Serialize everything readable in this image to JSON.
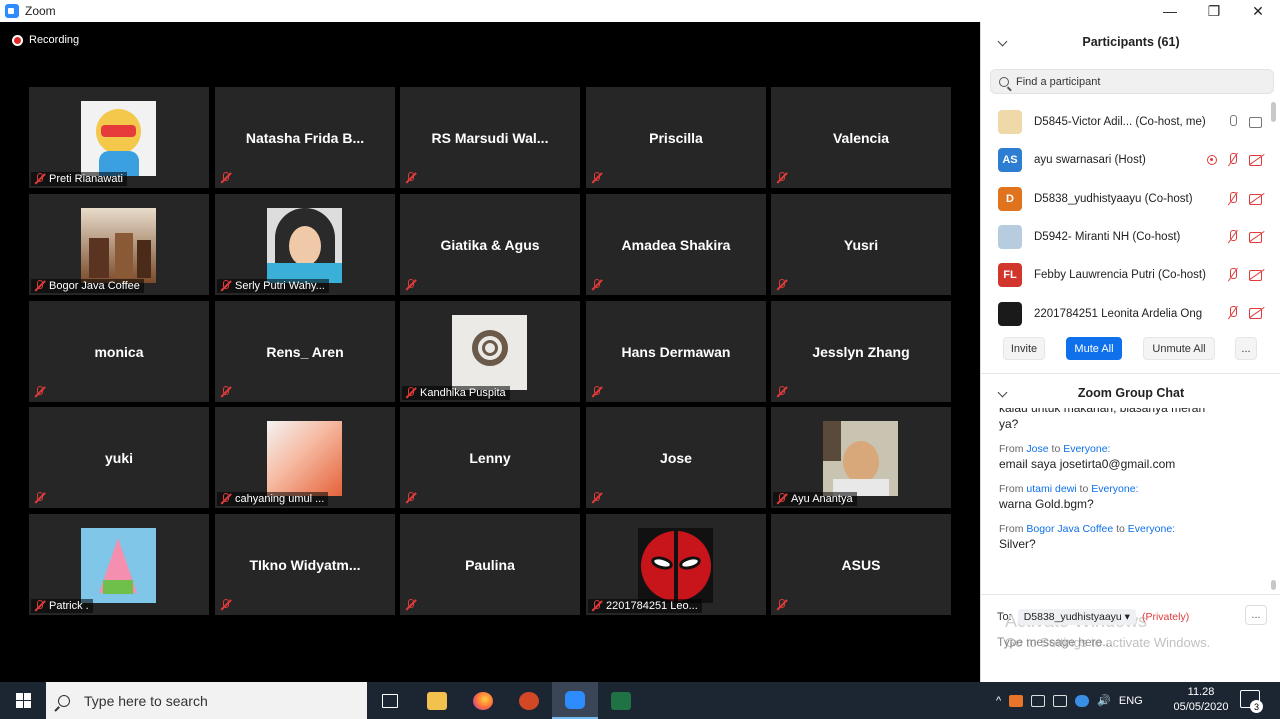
{
  "window": {
    "title": "Zoom"
  },
  "video": {
    "recording_label": "Recording",
    "tiles": [
      {
        "name": "Preti Rianawati",
        "avatar": "cartoon"
      },
      {
        "name": "Natasha Frida B..."
      },
      {
        "name": "RS  Marsudi  Wal..."
      },
      {
        "name": "Priscilla"
      },
      {
        "name": "Valencia"
      },
      {
        "name": "Bogor Java Coffee",
        "avatar": "coffee"
      },
      {
        "name": "Serly Putri Wahy...",
        "avatar": "hijab"
      },
      {
        "name": "Giatika & Agus"
      },
      {
        "name": "Amadea Shakira"
      },
      {
        "name": "Yusri"
      },
      {
        "name": "monica"
      },
      {
        "name": "Rens_ Aren"
      },
      {
        "name": "Kandhika Puspita",
        "avatar": "logo"
      },
      {
        "name": "Hans Dermawan"
      },
      {
        "name": "Jesslyn Zhang"
      },
      {
        "name": "yuki"
      },
      {
        "name": "cahyaning umul ...",
        "avatar": "orange"
      },
      {
        "name": "Lenny"
      },
      {
        "name": "Jose"
      },
      {
        "name": "Ayu Anantya",
        "avatar": "man"
      },
      {
        "name": "Patrick .",
        "avatar": "patrick"
      },
      {
        "name": "TIkno  Widyatm..."
      },
      {
        "name": "Paulina"
      },
      {
        "name": "2201784251 Leo...",
        "avatar": "deadpool"
      },
      {
        "name": "ASUS"
      }
    ]
  },
  "participants": {
    "title": "Participants (61)",
    "search_placeholder": "Find a participant",
    "list": [
      {
        "initials": "",
        "name": "D5845-Victor Adil... (Co-host, me)",
        "color": "#f0d9a8",
        "state": "me"
      },
      {
        "initials": "AS",
        "name": "ayu swarnasari (Host)",
        "color": "#2d7dd2",
        "state": "host"
      },
      {
        "initials": "D",
        "name": "D5838_yudhistyaayu (Co-host)",
        "color": "#e0731d",
        "state": "muted"
      },
      {
        "initials": "",
        "name": "D5942- Miranti NH (Co-host)",
        "color": "#b8cce0",
        "state": "muted"
      },
      {
        "initials": "FL",
        "name": "Febby Lauwrencia Putri (Co-host)",
        "color": "#d2352b",
        "state": "muted"
      },
      {
        "initials": "",
        "name": "2201784251 Leonita Ardelia Ong",
        "color": "#1a1a1a",
        "state": "muted"
      }
    ],
    "buttons": {
      "invite": "Invite",
      "mute_all": "Mute All",
      "unmute_all": "Unmute All",
      "more": "..."
    }
  },
  "chat": {
    "title": "Zoom Group Chat",
    "messages": [
      {
        "text": "kalau untuk makanan, biasanya meran"
      },
      {
        "text": "ya?"
      },
      {
        "from_label": "From",
        "from": "Jose",
        "to_label": "to",
        "to": "Everyone:",
        "text": "email saya josetirta0@gmail.com"
      },
      {
        "from_label": "From",
        "from": "utami dewi",
        "to_label": "to",
        "to": "Everyone:",
        "text": "warna Gold.bgm?"
      },
      {
        "from_label": "From",
        "from": "Bogor Java Coffee",
        "to_label": "to",
        "to": "Everyone:",
        "text": "Silver?"
      }
    ],
    "to_label": "To:",
    "to_value": "D5838_yudhistyaayu",
    "privately": "(Privately)",
    "more": "...",
    "placeholder": "Type message here...",
    "watermark_title": "Activate Windows",
    "watermark_sub": "Go to Settings to activate Windows."
  },
  "taskbar": {
    "search_placeholder": "Type here to search",
    "language": "ENG",
    "time": "11.28",
    "date": "05/05/2020",
    "notifications": "3"
  }
}
